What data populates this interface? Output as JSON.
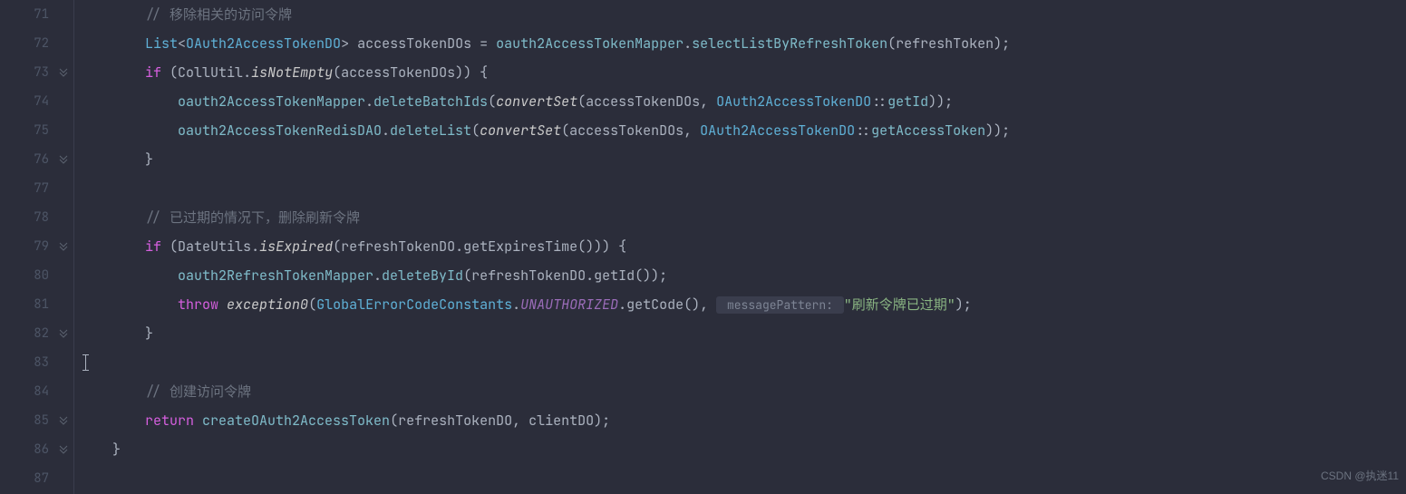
{
  "gutter": {
    "start": 71,
    "end": 87,
    "folds": [
      73,
      76,
      79,
      82,
      85,
      86
    ]
  },
  "code": {
    "l71": {
      "indent": "        ",
      "comment": "// 移除相关的访问令牌"
    },
    "l72": {
      "indent": "        ",
      "type_list": "List",
      "type_generic_open": "<",
      "type_inner": "OAuth2AccessTokenDO",
      "type_generic_close": ">",
      "var_decl": " accessTokenDOs = ",
      "obj1": "oauth2AccessTokenMapper",
      "dot1": ".",
      "method1": "selectListByRefreshToken",
      "args1": "(refreshToken);"
    },
    "l73": {
      "indent": "        ",
      "kw_if": "if",
      "open": " (",
      "cls": "CollUtil",
      "dot": ".",
      "method": "isNotEmpty",
      "args": "(accessTokenDOs)) {"
    },
    "l74": {
      "indent": "            ",
      "obj": "oauth2AccessTokenMapper",
      "dot": ".",
      "method": "deleteBatchIds",
      "open": "(",
      "fn": "convertSet",
      "args_mid": "(accessTokenDOs, ",
      "ref_cls": "OAuth2AccessTokenDO",
      "ref_sep": "::",
      "ref_method": "getId",
      "close": "));"
    },
    "l75": {
      "indent": "            ",
      "obj": "oauth2AccessTokenRedisDAO",
      "dot": ".",
      "method": "deleteList",
      "open": "(",
      "fn": "convertSet",
      "args_mid": "(accessTokenDOs, ",
      "ref_cls": "OAuth2AccessTokenDO",
      "ref_sep": "::",
      "ref_method": "getAccessToken",
      "close": "));"
    },
    "l76": {
      "indent": "        ",
      "brace": "}"
    },
    "l78": {
      "indent": "        ",
      "comment": "// 已过期的情况下，删除刷新令牌"
    },
    "l79": {
      "indent": "        ",
      "kw_if": "if",
      "open": " (",
      "cls": "DateUtils",
      "dot": ".",
      "method": "isExpired",
      "args": "(refreshTokenDO.getExpiresTime())) {"
    },
    "l80": {
      "indent": "            ",
      "obj": "oauth2RefreshTokenMapper",
      "dot": ".",
      "method": "deleteById",
      "args": "(refreshTokenDO.getId());"
    },
    "l81": {
      "indent": "            ",
      "kw_throw": "throw",
      "sp": " ",
      "fn": "exception0",
      "open": "(",
      "cls": "GlobalErrorCodeConstants",
      "dot": ".",
      "const": "UNAUTHORIZED",
      "call": ".getCode(), ",
      "hint": " messagePattern: ",
      "str": "\"刷新令牌已过期\"",
      "close": ");"
    },
    "l82": {
      "indent": "        ",
      "brace": "}"
    },
    "l84": {
      "indent": "        ",
      "comment": "// 创建访问令牌"
    },
    "l85": {
      "indent": "        ",
      "kw_return": "return",
      "sp": " ",
      "method": "createOAuth2AccessToken",
      "args": "(refreshTokenDO, clientDO);"
    },
    "l86": {
      "indent": "    ",
      "brace": "}"
    }
  },
  "watermark": "CSDN @执迷11"
}
